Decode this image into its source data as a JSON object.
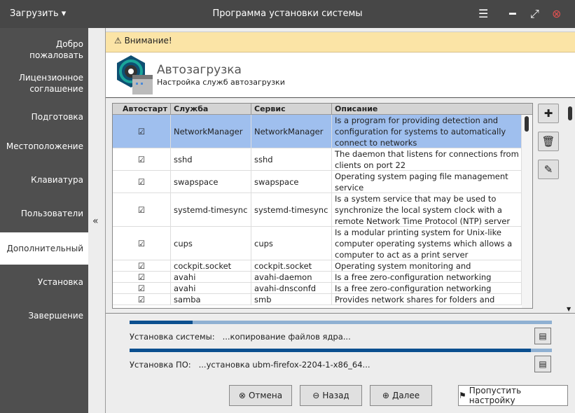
{
  "titlebar": {
    "menu": "Загрузить ▾",
    "title": "Программа установки системы"
  },
  "sidebar": {
    "items": [
      {
        "label": "Добро пожаловать"
      },
      {
        "label": "Лицензионное соглашение"
      },
      {
        "label": "Подготовка"
      },
      {
        "label": "Местоположение"
      },
      {
        "label": "Клавиатура"
      },
      {
        "label": "Пользователи"
      },
      {
        "label": "Дополнительный",
        "active": true
      },
      {
        "label": "Установка"
      },
      {
        "label": "Завершение"
      }
    ]
  },
  "warning": "Внимание!",
  "header": {
    "title": "Автозагрузка",
    "subtitle": "Настройка служб автозагрузки"
  },
  "table": {
    "columns": [
      "Автостарт",
      "Служба",
      "Сервис",
      "Описание"
    ],
    "rows": [
      {
        "checked": true,
        "service": "NetworkManager",
        "unit": "NetworkManager",
        "desc": "Is a program for providing detection and configuration for systems to automatically connect to networks",
        "selected": true
      },
      {
        "checked": true,
        "service": "sshd",
        "unit": "sshd",
        "desc": "The daemon that listens for connections from clients on port 22"
      },
      {
        "checked": true,
        "service": "swapspace",
        "unit": "swapspace",
        "desc": "Operating system paging file management service"
      },
      {
        "checked": true,
        "service": "systemd-timesync",
        "unit": "systemd-timesync",
        "desc": "Is a system service that may be used to synchronize the local system clock with a remote Network Time Protocol (NTP) server"
      },
      {
        "checked": true,
        "service": "cups",
        "unit": "cups",
        "desc": "Is a modular printing system for Unix-like computer operating systems which allows a computer to act as a print server"
      },
      {
        "checked": true,
        "service": "cockpit.socket",
        "unit": "cockpit.socket",
        "desc": "Operating system monitoring and management"
      },
      {
        "checked": true,
        "service": "avahi",
        "unit": "avahi-daemon",
        "desc": "Is a free zero-configuration networking (zeroconf)"
      },
      {
        "checked": true,
        "service": "avahi",
        "unit": "avahi-dnsconfd",
        "desc": "Is a free zero-configuration networking (zeroconf)"
      },
      {
        "checked": true,
        "service": "samba",
        "unit": "smb",
        "desc": "Provides network shares for folders and printers"
      }
    ]
  },
  "progress": {
    "system": {
      "label": "Установка системы:",
      "status": "...копирование файлов ядра...",
      "percent": 15
    },
    "software": {
      "label": "Установка ПО:",
      "status": "...установка ubm-firefox-2204-1-x86_64...",
      "percent": 95
    }
  },
  "buttons": {
    "cancel": "Отмена",
    "back": "Назад",
    "next": "Далее",
    "skip": "Пропустить настройку"
  }
}
